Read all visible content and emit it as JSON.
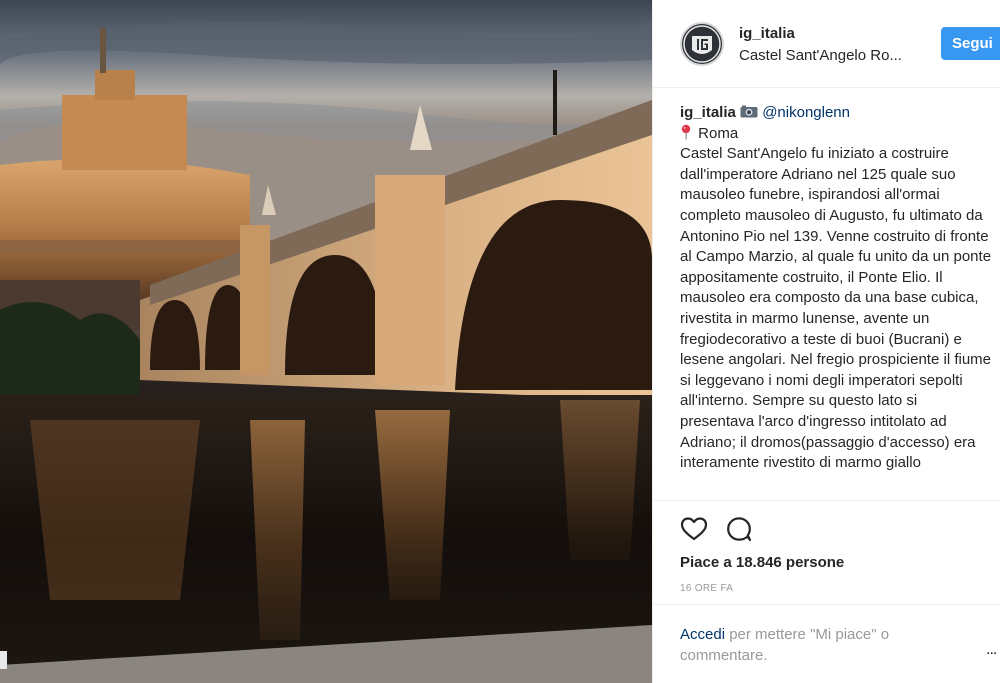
{
  "post": {
    "image_alt": "Castel Sant'Angelo e Ponte Sant'Angelo al tramonto, Roma"
  },
  "header": {
    "username": "ig_italia",
    "location": "Castel Sant'Angelo Ro...",
    "follow_label": "Segui"
  },
  "caption": {
    "username": "ig_italia",
    "mention": "@nikonglenn",
    "place": "Roma",
    "text": "Castel Sant'Angelo fu iniziato a costruire dall'imperatore Adriano nel 125 quale suo mausoleo funebre, ispirandosi all'ormai completo mausoleo di Augusto, fu ultimato da Antonino Pio nel 139. Venne costruito di fronte al Campo Marzio, al quale fu unito da un ponte appositamente costruito, il Ponte Elio. Il mausoleo era composto da una base cubica, rivestita in marmo lunense, avente un fregiodecorativo a teste di buoi (Bucrani) e lesene angolari. Nel fregio prospiciente il fiume si leggevano i nomi degli imperatori sepolti all'interno. Sempre su questo lato si presentava l'arco d'ingresso intitolato ad Adriano; il dromos(passaggio d'accesso) era interamente rivestito di marmo giallo"
  },
  "actions": {
    "likes": "Piace a 18.846 persone",
    "timestamp": "16 ORE FA"
  },
  "login": {
    "link_label": "Accedi",
    "rest_text": " per mettere \"Mi piace\" o commentare.",
    "more_label": "..."
  },
  "colors": {
    "follow_button": "#3897f0",
    "link": "#003569",
    "muted_text": "#999999"
  },
  "icons": {
    "heart": "heart-icon",
    "comment": "comment-icon",
    "camera": "camera-icon",
    "pin": "pin-icon"
  }
}
